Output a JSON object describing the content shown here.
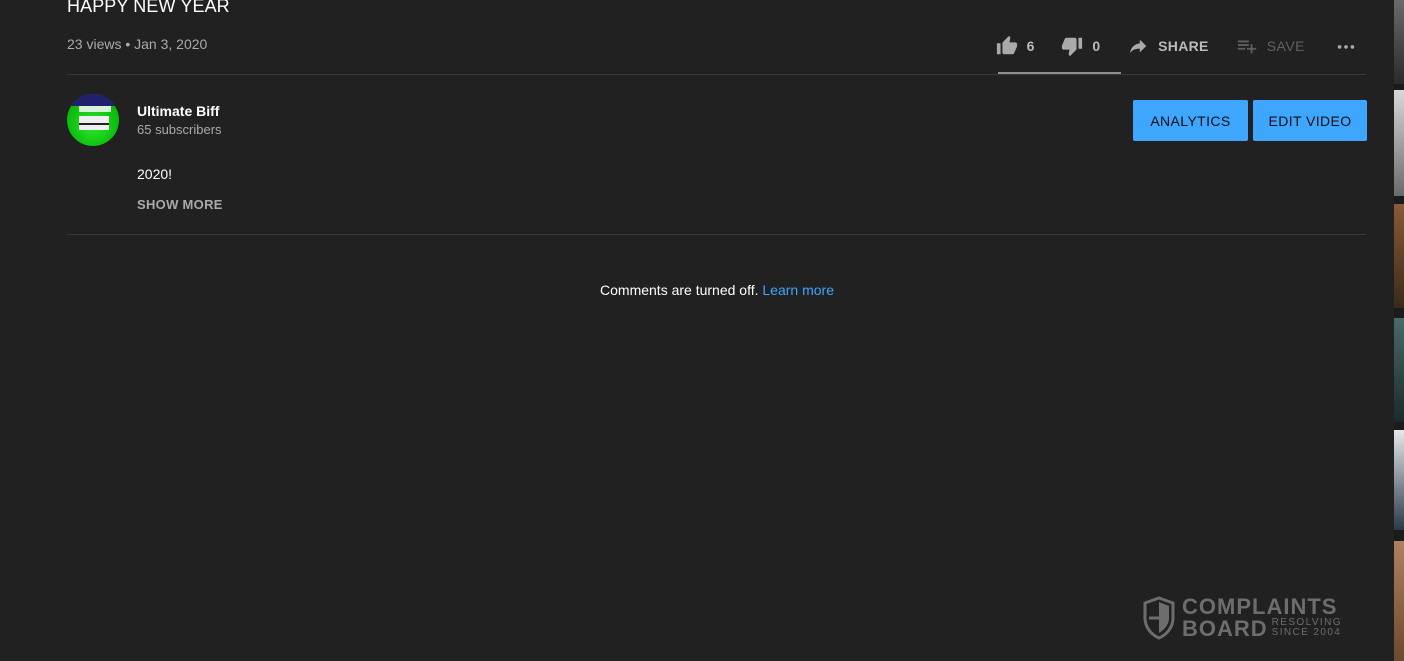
{
  "video": {
    "title": "HAPPY NEW YEAR",
    "meta": "23 views • Jan 3, 2020"
  },
  "actions": {
    "like_count": "6",
    "dislike_count": "0",
    "share_label": "SHARE",
    "save_label": "SAVE"
  },
  "owner": {
    "channel_name": "Ultimate Biff",
    "subscribers": "65 subscribers",
    "analytics_label": "ANALYTICS",
    "edit_label": "EDIT VIDEO"
  },
  "description": {
    "text": "2020!",
    "show_more": "SHOW MORE"
  },
  "comments": {
    "off_text": "Comments are turned off.",
    "learn_more": "Learn more"
  },
  "watermark": {
    "line1": "COMPLAINTS",
    "line2": "BOARD",
    "tag1": "RESOLVING",
    "tag2": "SINCE 2004"
  },
  "colors": {
    "background": "#212121",
    "accent": "#3ea6ff",
    "secondary_text": "#aaaaaa"
  },
  "icons": [
    "thumb-up-icon",
    "thumb-down-icon",
    "share-icon",
    "playlist-add-icon",
    "more-icon",
    "shield-icon"
  ]
}
